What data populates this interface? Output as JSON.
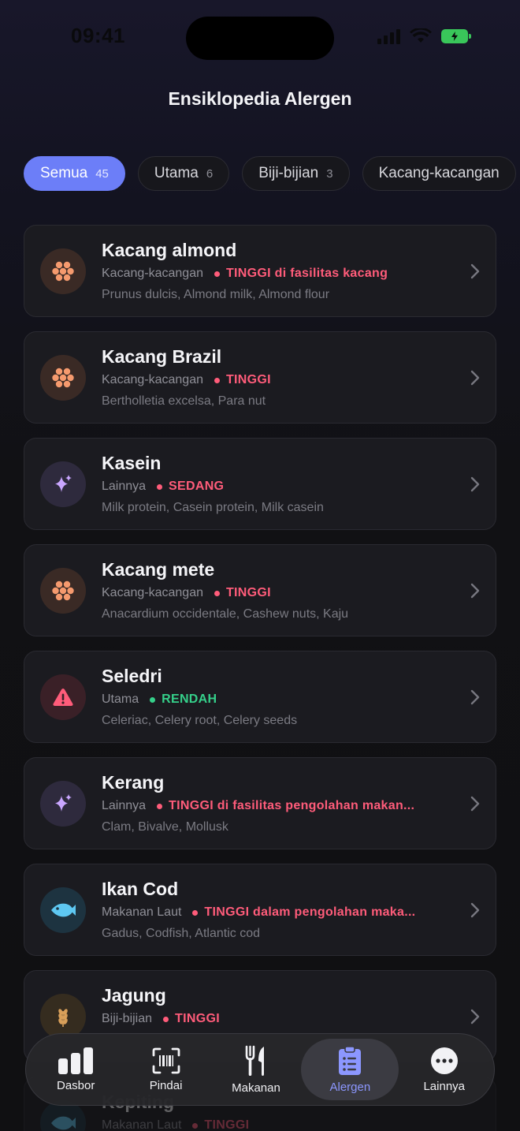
{
  "status": {
    "time": "09:41"
  },
  "header": {
    "title": "Ensiklopedia Alergen"
  },
  "chips": [
    {
      "label": "Semua",
      "count": "45",
      "active": true
    },
    {
      "label": "Utama",
      "count": "6"
    },
    {
      "label": "Biji-bijian",
      "count": "3"
    },
    {
      "label": "Kacang-kacangan",
      "count": ""
    }
  ],
  "allergens": [
    {
      "name": "Kacang almond",
      "category": "Kacang-kacangan",
      "level": "TINGGI di fasilitas kacang",
      "level_color": "#ff5c7a",
      "aliases": "Prunus dulcis, Almond milk, Almond flour",
      "icon": "nut-icon"
    },
    {
      "name": "Kacang Brazil",
      "category": "Kacang-kacangan",
      "level": "TINGGI",
      "level_color": "#ff5c7a",
      "aliases": "Bertholletia excelsa, Para nut",
      "icon": "nut-icon"
    },
    {
      "name": "Kasein",
      "category": "Lainnya",
      "level": "SEDANG",
      "level_color": "#ff5c7a",
      "aliases": "Milk protein, Casein protein, Milk casein",
      "icon": "sparkle-icon"
    },
    {
      "name": "Kacang mete",
      "category": "Kacang-kacangan",
      "level": "TINGGI",
      "level_color": "#ff5c7a",
      "aliases": "Anacardium occidentale, Cashew nuts, Kaju",
      "icon": "nut-icon"
    },
    {
      "name": "Seledri",
      "category": "Utama",
      "level": "RENDAH",
      "level_color": "#35d08a",
      "aliases": "Celeriac, Celery root, Celery seeds",
      "icon": "warning-icon"
    },
    {
      "name": "Kerang",
      "category": "Lainnya",
      "level": "TINGGI di fasilitas pengolahan makan...",
      "level_color": "#ff5c7a",
      "aliases": "Clam, Bivalve, Mollusk",
      "icon": "sparkle-icon"
    },
    {
      "name": "Ikan Cod",
      "category": "Makanan Laut",
      "level": "TINGGI dalam pengolahan maka...",
      "level_color": "#ff5c7a",
      "aliases": "Gadus, Codfish, Atlantic cod",
      "icon": "fish-icon"
    },
    {
      "name": "Jagung",
      "category": "Biji-bijian",
      "level": "TINGGI",
      "level_color": "#ff5c7a",
      "aliases": "",
      "icon": "wheat-icon"
    },
    {
      "name": "Kepiting",
      "category": "Makanan Laut",
      "level": "TINGGI",
      "level_color": "#ff5c7a",
      "aliases": "",
      "icon": "fish-icon"
    }
  ],
  "tabbar": {
    "items": [
      {
        "label": "Dasbor",
        "icon": "chart-bars-icon"
      },
      {
        "label": "Pindai",
        "icon": "barcode-scan-icon"
      },
      {
        "label": "Makanan",
        "icon": "fork-knife-icon"
      },
      {
        "label": "Alergen",
        "icon": "clipboard-list-icon",
        "active": true
      },
      {
        "label": "Lainnya",
        "icon": "more-dots-icon"
      }
    ]
  },
  "colors": {
    "accent": "#6c7ef8",
    "high": "#ff5c7a",
    "low": "#35d08a",
    "tab_active": "#8c97ff"
  }
}
